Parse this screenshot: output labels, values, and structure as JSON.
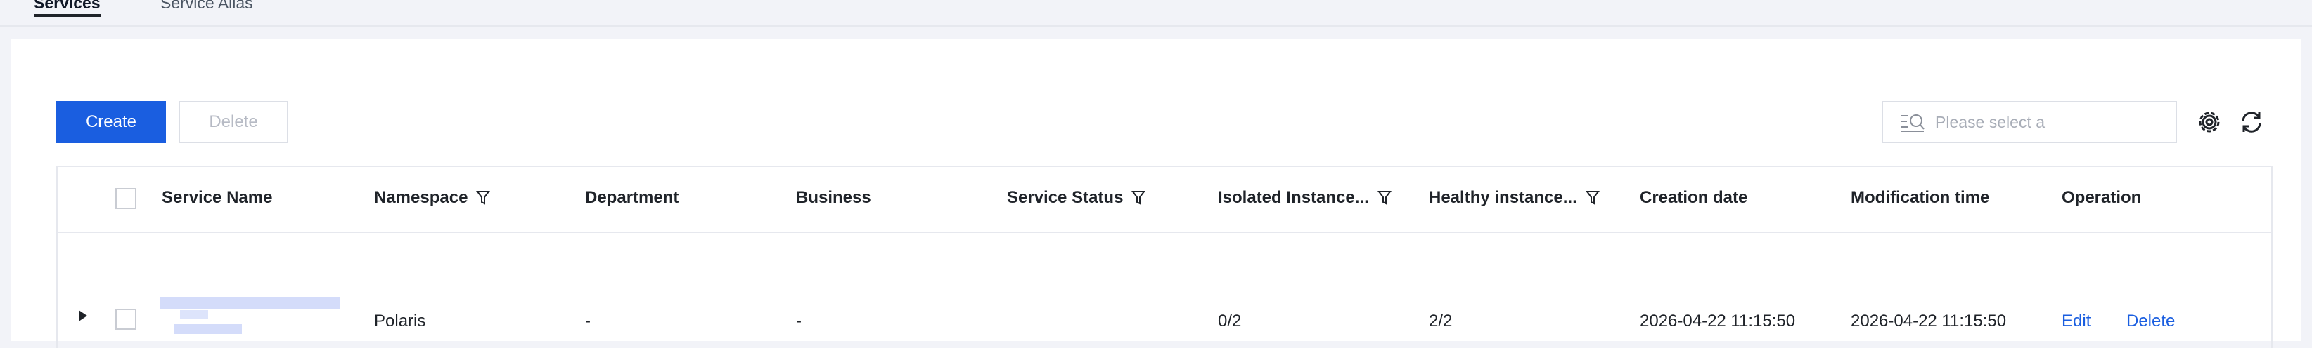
{
  "tabs": [
    {
      "label": "Services",
      "active": true
    },
    {
      "label": "Service Alias",
      "active": false
    }
  ],
  "toolbar": {
    "create_label": "Create",
    "delete_label": "Delete",
    "search_placeholder": "Please select a"
  },
  "table": {
    "columns": {
      "service_name": "Service Name",
      "namespace": "Namespace",
      "department": "Department",
      "business": "Business",
      "service_status": "Service Status",
      "isolated_instances": "Isolated Instance...",
      "healthy_instances": "Healthy instance...",
      "creation_date": "Creation date",
      "modification_time": "Modification time",
      "operation": "Operation"
    },
    "rows": [
      {
        "namespace": "Polaris",
        "department": "-",
        "business": "-",
        "service_status": "",
        "isolated_instances": "0/2",
        "healthy_instances": "2/2",
        "creation_date": "2026-04-22 11:15:50",
        "modification_time": "2026-04-22 11:15:50",
        "edit_label": "Edit",
        "delete_label": "Delete"
      }
    ]
  },
  "icons": [
    "search-icon",
    "gear-icon",
    "refresh-icon",
    "filter-icon",
    "expand-arrow-icon"
  ],
  "colors": {
    "primary": "#1a5ee0",
    "background": "#f2f3f8",
    "border": "#e6e8ee"
  }
}
